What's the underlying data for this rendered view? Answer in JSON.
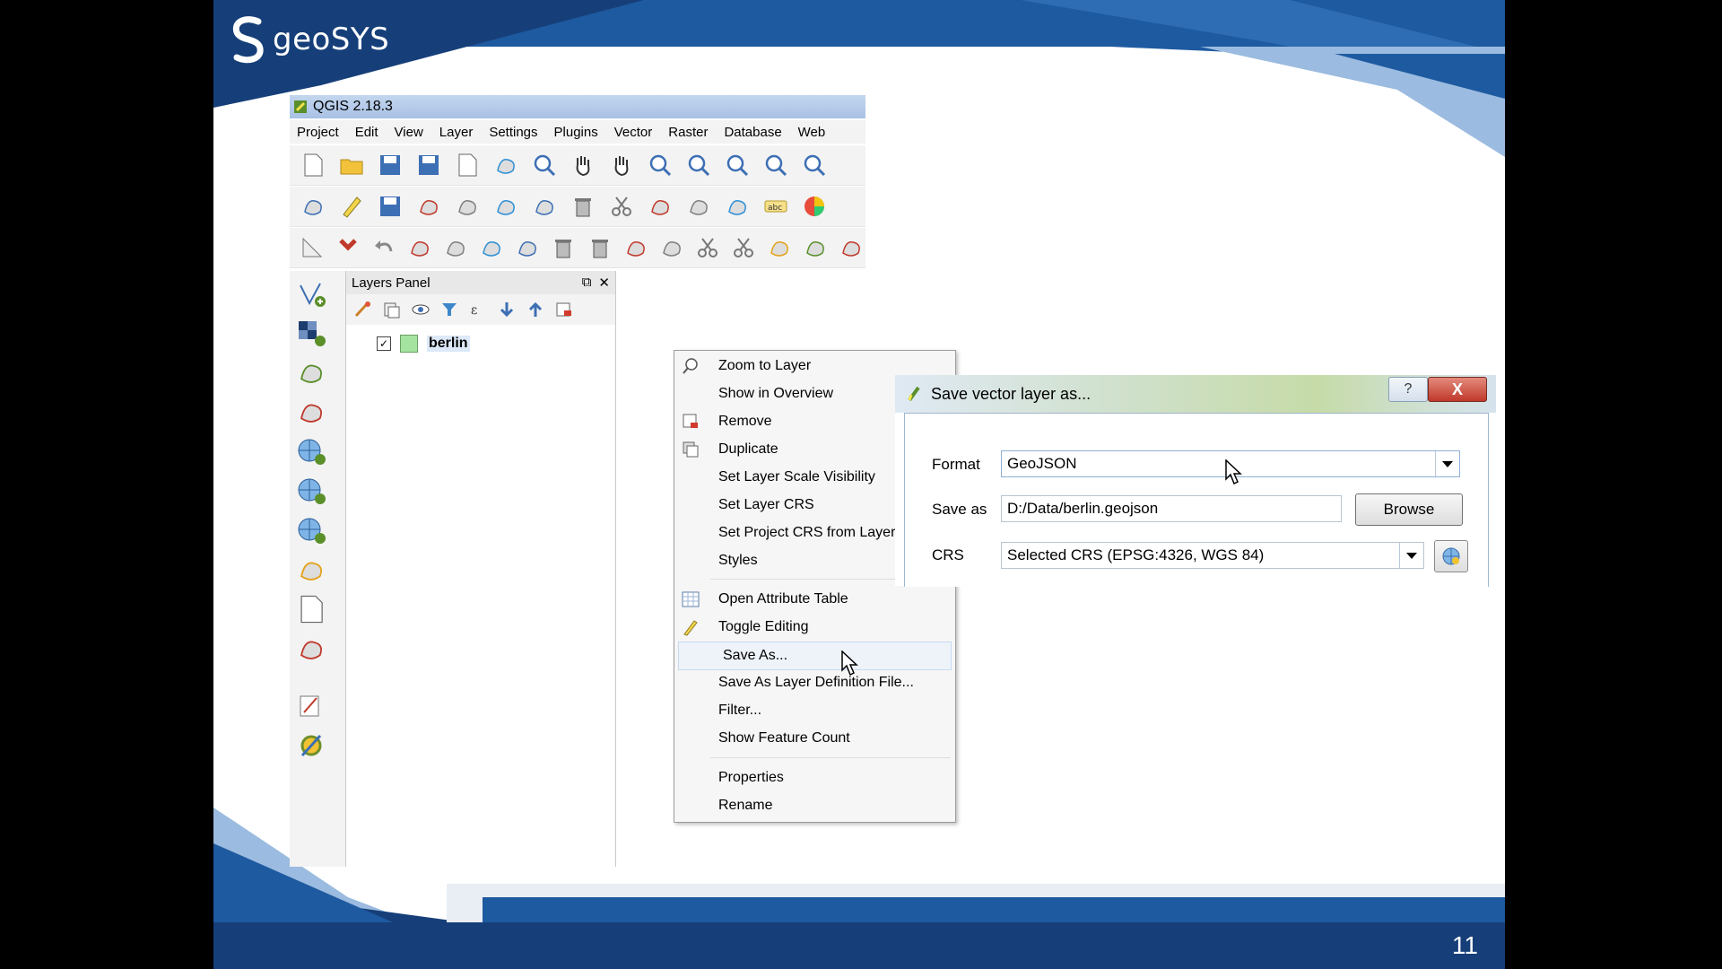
{
  "slide": {
    "logo_text": "geoSYS",
    "page_number": "11",
    "colors": {
      "brand_blue": "#1e5aa0",
      "dark_blue": "#163f79",
      "light_blue": "#9bbbe0"
    }
  },
  "qgis": {
    "title": "QGIS 2.18.3",
    "menu": [
      "Project",
      "Edit",
      "View",
      "Layer",
      "Settings",
      "Plugins",
      "Vector",
      "Raster",
      "Database",
      "Web"
    ],
    "toolbar1_icons": [
      "new-project-icon",
      "open-project-icon",
      "save-project-icon",
      "save-as-icon",
      "new-print-composer-icon",
      "composer-manager-icon",
      "touch-zoom-icon",
      "pan-icon",
      "pan-to-selection-icon",
      "zoom-in-icon",
      "zoom-out-icon",
      "zoom-native-icon",
      "zoom-full-icon",
      "zoom-to-selection-icon"
    ],
    "toolbar2_icons": [
      "current-edits-icon",
      "toggle-editing-icon",
      "save-edits-icon",
      "add-feature-icon",
      "add-circular-string-icon",
      "move-feature-icon",
      "node-tool-icon",
      "delete-selected-icon",
      "cut-features-icon",
      "copy-features-icon",
      "paste-features-icon",
      "vertex-tool-icon",
      "label-icon",
      "diagram-icon"
    ],
    "toolbar3_icons": [
      "measure-icon",
      "snapping-icon",
      "undo-icon",
      "simplify-icon",
      "add-ring-icon",
      "add-part-icon",
      "fill-ring-icon",
      "delete-ring-icon",
      "delete-part-icon",
      "reshape-icon",
      "offset-curve-icon",
      "split-features-icon",
      "split-parts-icon",
      "merge-features-icon",
      "merge-attributes-icon",
      "rotate-icon"
    ],
    "leftbar_icons": [
      "add-vector-layer-icon",
      "add-raster-layer-icon",
      "add-spatialite-layer-icon",
      "add-postgis-layer-icon",
      "add-wms-layer-icon",
      "add-wcs-layer-icon",
      "add-wfs-layer-icon",
      "add-delimited-text-icon",
      "new-shapefile-icon",
      "add-virtual-layer-icon",
      "georeferencer-icon",
      "processing-icon"
    ],
    "layers_panel": {
      "title": "Layers Panel",
      "layer": {
        "name": "berlin",
        "checked": true
      }
    }
  },
  "context_menu": {
    "items": [
      {
        "label": "Zoom to Layer",
        "icon": "zoom-to-layer-icon"
      },
      {
        "label": "Show in Overview",
        "icon": ""
      },
      {
        "label": "Remove",
        "icon": "remove-layer-icon"
      },
      {
        "label": "Duplicate",
        "icon": "duplicate-layer-icon"
      },
      {
        "label": "Set Layer Scale Visibility",
        "icon": ""
      },
      {
        "label": "Set Layer CRS",
        "icon": ""
      },
      {
        "label": "Set Project CRS from Layer",
        "icon": ""
      },
      {
        "label": "Styles",
        "icon": "",
        "submenu": true
      },
      {
        "label": "Open Attribute Table",
        "icon": "attribute-table-icon"
      },
      {
        "label": "Toggle Editing",
        "icon": "pencil-icon"
      },
      {
        "label": "Save As...",
        "icon": "",
        "highlighted": true
      },
      {
        "label": "Save As Layer Definition File...",
        "icon": ""
      },
      {
        "label": "Filter...",
        "icon": ""
      },
      {
        "label": "Show Feature Count",
        "icon": ""
      },
      {
        "label": "Properties",
        "icon": ""
      },
      {
        "label": "Rename",
        "icon": ""
      }
    ]
  },
  "dialog": {
    "title": "Save vector layer as...",
    "help_label": "?",
    "close_label": "X",
    "format_label": "Format",
    "format_value": "GeoJSON",
    "save_as_label": "Save as",
    "save_as_value": "D:/Data/berlin.geojson",
    "browse_label": "Browse",
    "crs_label": "CRS",
    "crs_value": "Selected CRS (EPSG:4326, WGS 84)"
  }
}
